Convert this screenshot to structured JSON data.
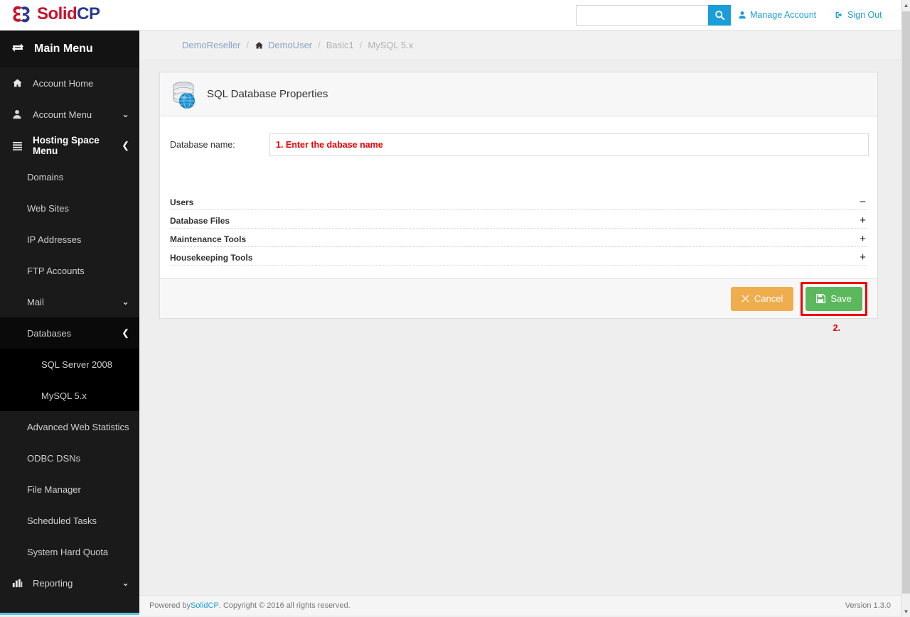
{
  "brand": {
    "name_first": "Solid",
    "name_second": "CP",
    "color_primary": "#c8102e",
    "color_secondary": "#2b3990",
    "accent_blue": "#1b9dd9"
  },
  "header": {
    "search": {
      "value": "",
      "placeholder": "",
      "icon": "search-icon"
    },
    "manage_account": "Manage Account",
    "sign_out": "Sign Out"
  },
  "sidebar": {
    "title": "Main Menu",
    "title_icon": "exchange-arrows-icon",
    "items": [
      {
        "label": "Account Home",
        "icon": "home-icon",
        "indent": 0,
        "chevron": ""
      },
      {
        "label": "Account Menu",
        "icon": "user-icon",
        "indent": 0,
        "chevron": "⌄"
      },
      {
        "label": "Hosting Space Menu",
        "icon": "list-icon",
        "indent": 0,
        "chevron": "❮"
      },
      {
        "label": "Domains",
        "icon": "",
        "indent": 1,
        "chevron": ""
      },
      {
        "label": "Web Sites",
        "icon": "",
        "indent": 1,
        "chevron": ""
      },
      {
        "label": "IP Addresses",
        "icon": "",
        "indent": 1,
        "chevron": ""
      },
      {
        "label": "FTP Accounts",
        "icon": "",
        "indent": 1,
        "chevron": ""
      },
      {
        "label": "Mail",
        "icon": "",
        "indent": 1,
        "chevron": "⌄"
      },
      {
        "label": "Databases",
        "icon": "",
        "indent": 1,
        "chevron": "❮"
      },
      {
        "label": "SQL Server 2008",
        "icon": "",
        "indent": 2,
        "chevron": ""
      },
      {
        "label": "MySQL 5.x",
        "icon": "",
        "indent": 2,
        "chevron": ""
      },
      {
        "label": "Advanced Web Statistics",
        "icon": "",
        "indent": 1,
        "chevron": ""
      },
      {
        "label": "ODBC DSNs",
        "icon": "",
        "indent": 1,
        "chevron": ""
      },
      {
        "label": "File Manager",
        "icon": "",
        "indent": 1,
        "chevron": ""
      },
      {
        "label": "Scheduled Tasks",
        "icon": "",
        "indent": 1,
        "chevron": ""
      },
      {
        "label": "System Hard Quota",
        "icon": "",
        "indent": 1,
        "chevron": ""
      },
      {
        "label": "Reporting",
        "icon": "chart-bar-icon",
        "indent": 0,
        "chevron": "⌄"
      }
    ]
  },
  "breadcrumb": {
    "items": [
      {
        "label": "DemoReseller",
        "type": "link",
        "icon": ""
      },
      {
        "label": "DemoUser",
        "type": "link",
        "icon": "home-icon"
      },
      {
        "label": "Basic1",
        "type": "plain",
        "icon": ""
      },
      {
        "label": "MySQL 5.x",
        "type": "plain",
        "icon": ""
      }
    ],
    "separator": "/"
  },
  "panel": {
    "icon": "database-globe-icon",
    "title": "SQL Database Properties",
    "form": {
      "database_name_label": "Database name:",
      "database_name_value": "1. Enter the dabase name",
      "database_name_placeholder": ""
    },
    "accordion": [
      {
        "title": "Users",
        "sign": "−",
        "expanded": true
      },
      {
        "title": "Database Files",
        "sign": "+",
        "expanded": false
      },
      {
        "title": "Maintenance Tools",
        "sign": "+",
        "expanded": false
      },
      {
        "title": "Housekeeping Tools",
        "sign": "+",
        "expanded": false
      }
    ],
    "annotation_step2": "2.",
    "buttons": {
      "cancel": "Cancel",
      "cancel_icon": "x-icon",
      "save": "Save",
      "save_icon": "floppy-disk-icon"
    }
  },
  "footer": {
    "prefix": "Powered by ",
    "link": "SolidCP",
    "suffix": ". Copyright © 2016 all rights reserved.",
    "version": "Version  1.3.0"
  },
  "scrollbar": {
    "up": "▲",
    "down": "▼"
  }
}
